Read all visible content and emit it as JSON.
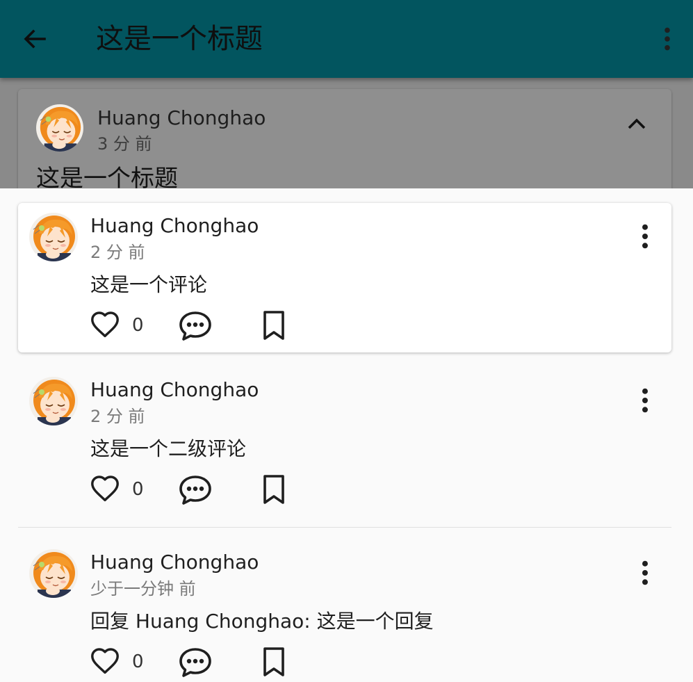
{
  "appbar": {
    "title": "这是一个标题",
    "back_icon": "arrow-back-icon",
    "more_icon": "more-vert-icon",
    "background": "#02555f"
  },
  "post": {
    "author": "Huang Chonghao",
    "time": "3 分 前",
    "title": "这是一个标题",
    "collapse_icon": "chevron-up-icon"
  },
  "comments": [
    {
      "author": "Huang Chonghao",
      "time": "2 分 前",
      "content": "这是一个评论",
      "likes": "0"
    },
    {
      "author": "Huang Chonghao",
      "time": "2 分 前",
      "content": "这是一个二级评论",
      "likes": "0"
    },
    {
      "author": "Huang Chonghao",
      "time": "少于一分钟 前",
      "content": "回复 Huang Chonghao: 这是一个回复",
      "likes": "0"
    }
  ],
  "icons": {
    "like": "heart-outline-icon",
    "comment": "comment-bubble-icon",
    "bookmark": "bookmark-outline-icon"
  }
}
